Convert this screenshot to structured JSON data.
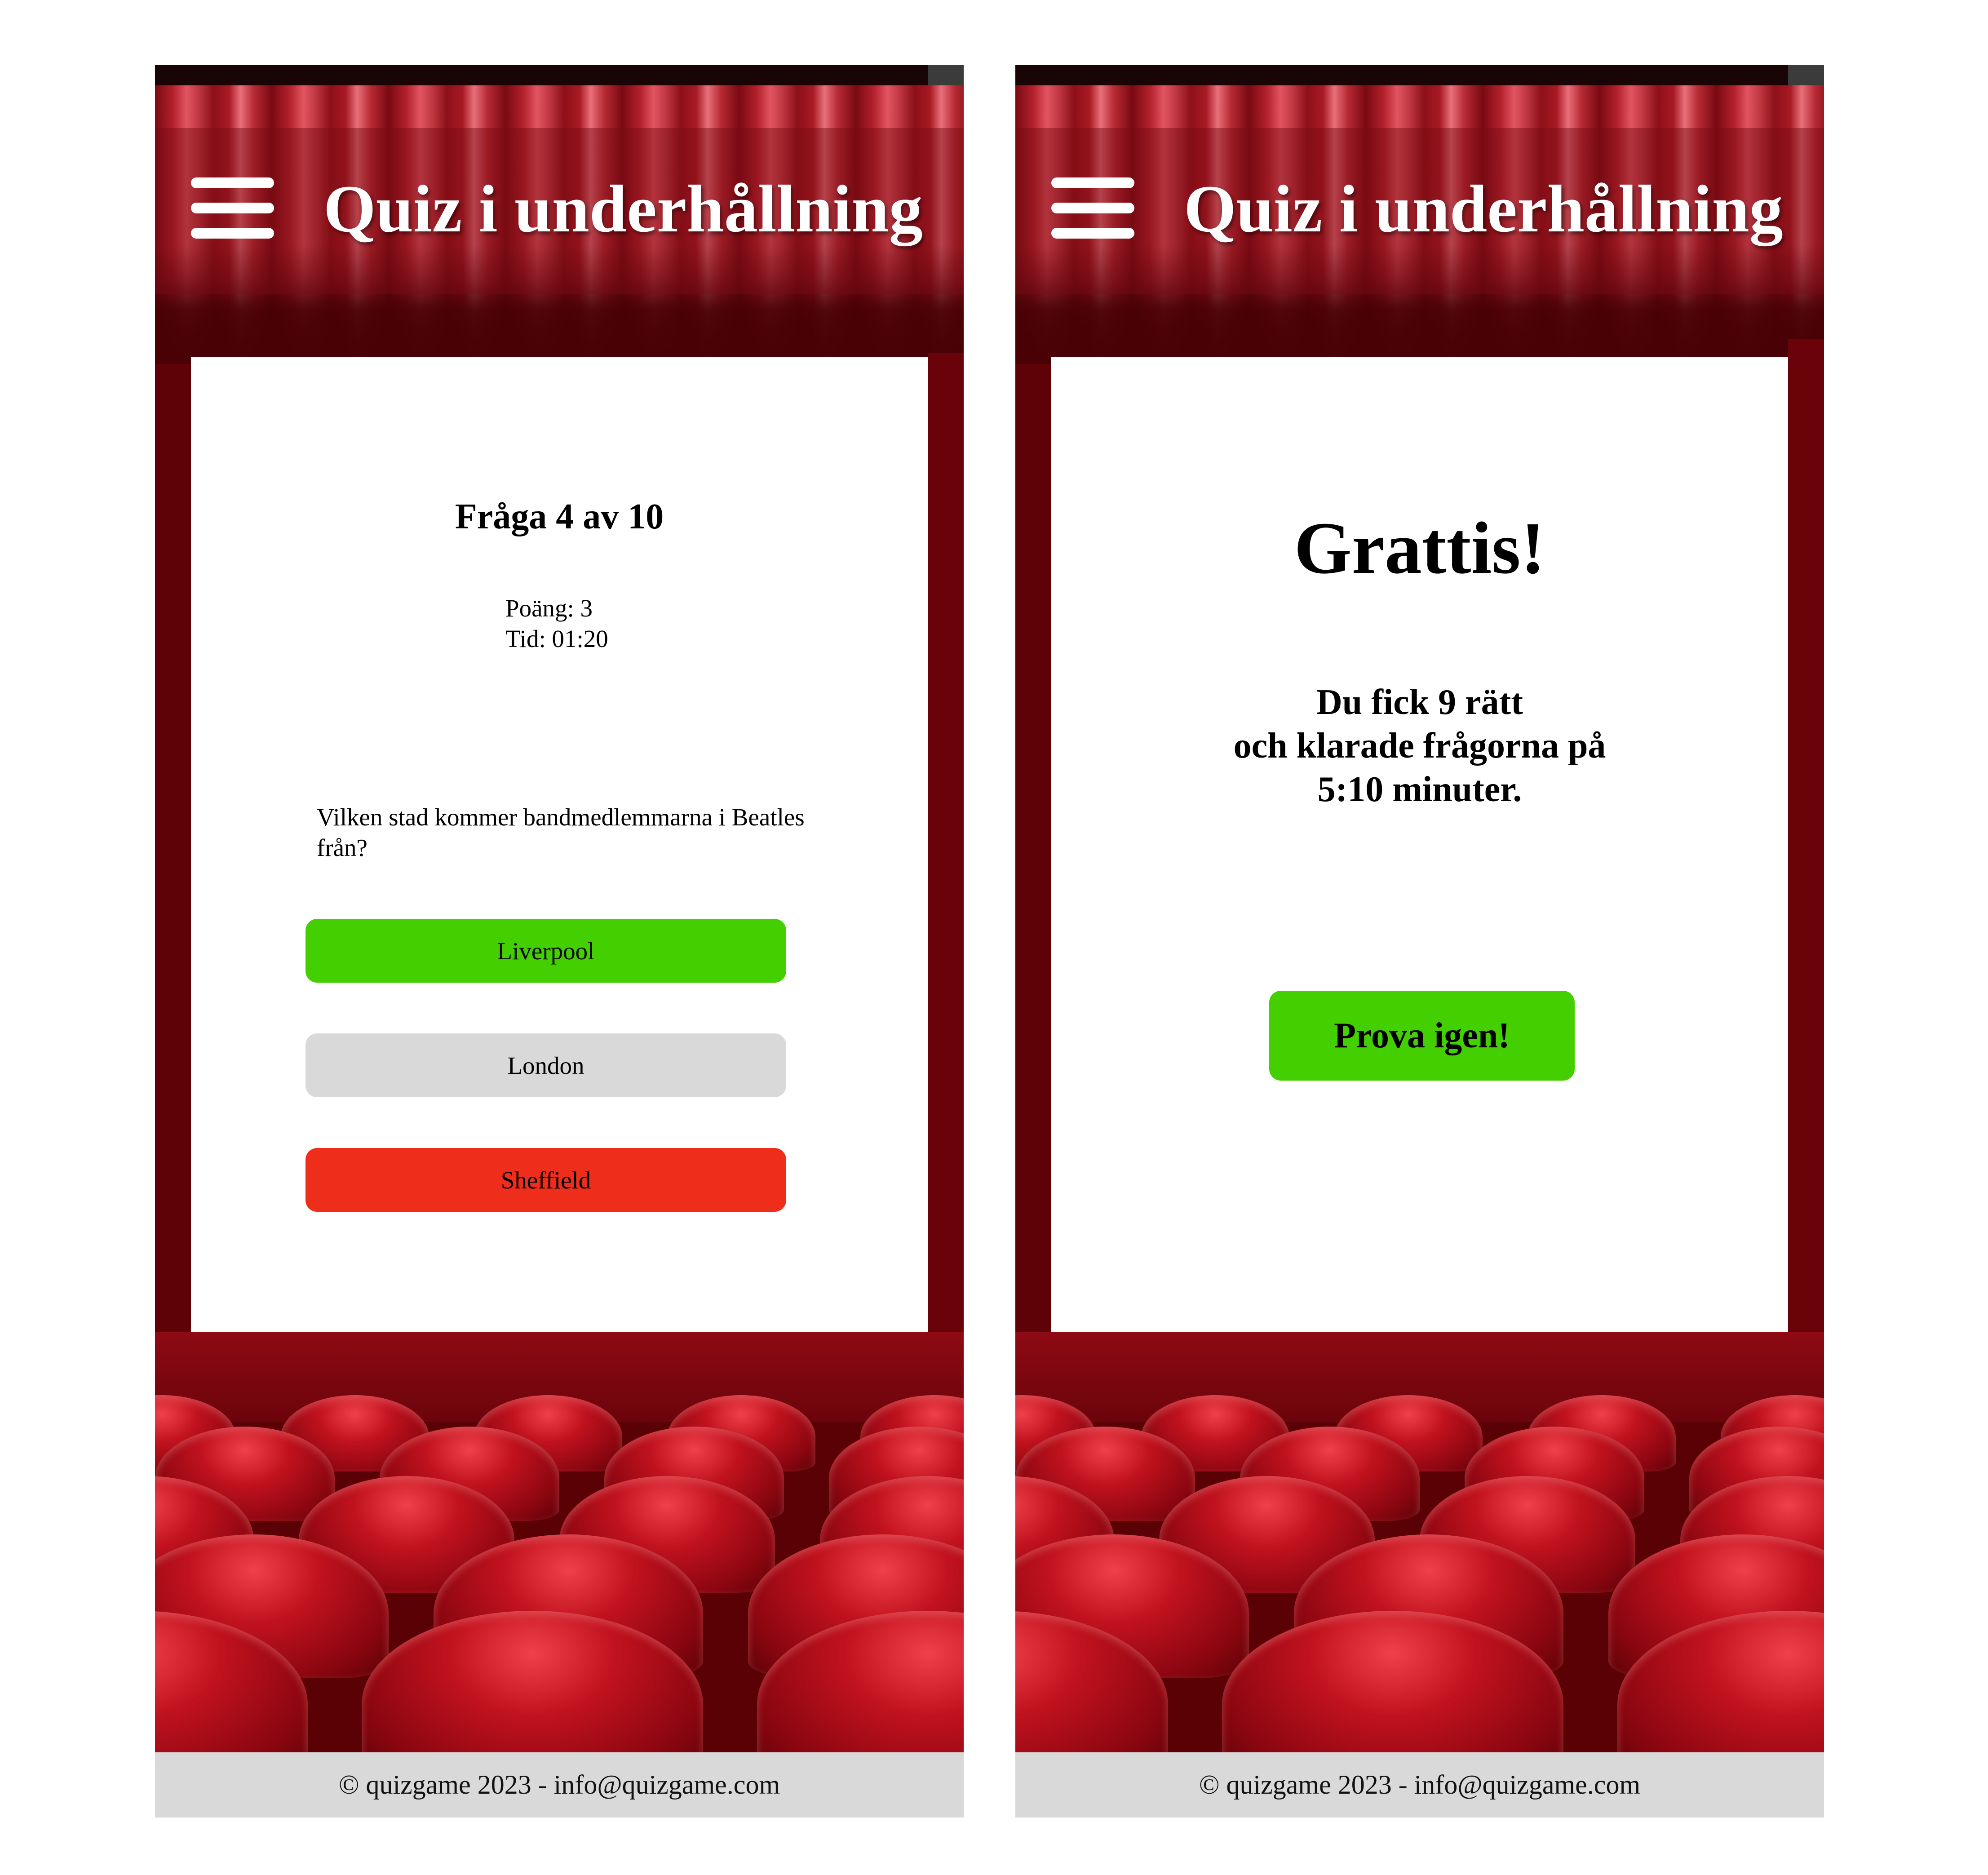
{
  "app": {
    "title": "Quiz i underhållning",
    "menu_icon": "hamburger-menu-icon",
    "footer": "© quizgame 2023 - info@quizgame.com"
  },
  "quiz_screen": {
    "heading": "Fråga 4 av 10",
    "score_label": "Poäng: 3",
    "time_label": "Tid: 01:20",
    "question": "Vilken stad kommer bandmedlemmarna i Beatles från?",
    "answers": [
      {
        "label": "Liverpool",
        "state": "correct",
        "color": "#44d000"
      },
      {
        "label": "London",
        "state": "neutral",
        "color": "#d9d9d9"
      },
      {
        "label": "Sheffield",
        "state": "wrong",
        "color": "#ee2d1a"
      }
    ]
  },
  "result_screen": {
    "heading": "Grattis!",
    "line1": "Du fick 9 rätt",
    "line2": "och klarade frågorna på",
    "line3": "5:10 minuter.",
    "retry_label": "Prova igen!",
    "retry_color": "#44d000"
  },
  "colors": {
    "stage_dark_red": "#5e0207",
    "curtain_red": "#b3212c",
    "footer_bg": "#d9d9d9"
  }
}
